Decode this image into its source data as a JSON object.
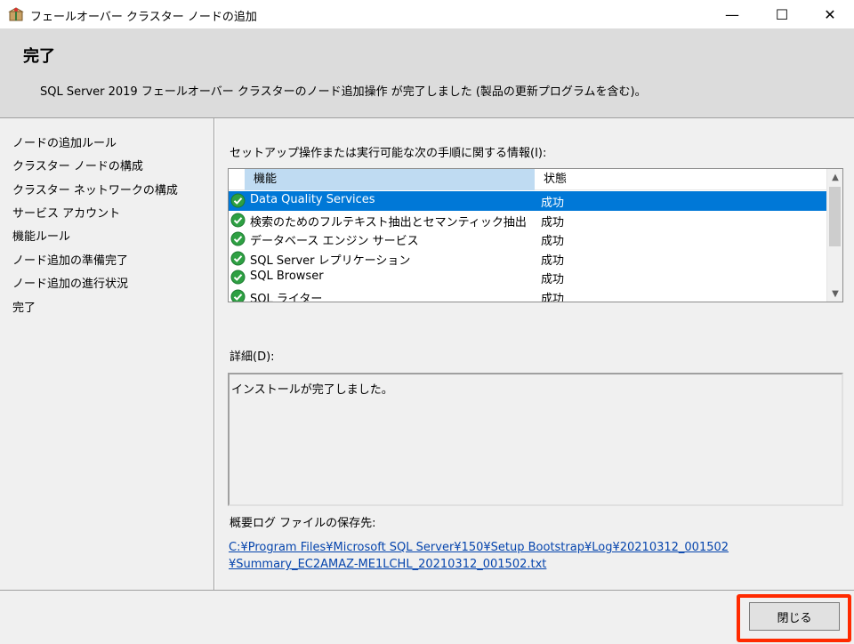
{
  "window": {
    "title": "フェールオーバー クラスター ノードの追加",
    "controls": {
      "minimize": "—",
      "maximize": "☐",
      "close": "✕"
    }
  },
  "header": {
    "title": "完了",
    "subtitle": "SQL Server 2019 フェールオーバー クラスターのノード追加操作 が完了しました (製品の更新プログラムを含む)。"
  },
  "sidebar": {
    "items": [
      "ノードの追加ルール",
      "クラスター ノードの構成",
      "クラスター ネットワークの構成",
      "サービス アカウント",
      "機能ルール",
      "ノード追加の準備完了",
      "ノード追加の進行状況",
      "完了"
    ]
  },
  "main": {
    "info_label": "セットアップ操作または実行可能な次の手順に関する情報(I):",
    "grid": {
      "columns": [
        "機能",
        "状態"
      ],
      "rows": [
        {
          "feature": "Data Quality Services",
          "status": "成功",
          "selected": true
        },
        {
          "feature": "検索のためのフルテキスト抽出とセマンティック抽出",
          "status": "成功"
        },
        {
          "feature": "データベース エンジン サービス",
          "status": "成功"
        },
        {
          "feature": "SQL Server レプリケーション",
          "status": "成功"
        },
        {
          "feature": "SQL Browser",
          "status": "成功"
        },
        {
          "feature": "SQL ライター",
          "status": "成功"
        }
      ]
    },
    "details_label": "詳細(D):",
    "details_text": "インストールが完了しました。",
    "log_label": "概要ログ ファイルの保存先:",
    "log_link_line1": "C:¥Program Files¥Microsoft SQL Server¥150¥Setup Bootstrap¥Log¥20210312_001502",
    "log_link_line2": "¥Summary_EC2AMAZ-ME1LCHL_20210312_001502.txt"
  },
  "footer": {
    "close_label": "閉じる"
  },
  "colors": {
    "selection": "#0078d7",
    "highlight_box": "#ff2a00",
    "link": "#0645ad",
    "success_icon": "#2ea043"
  }
}
